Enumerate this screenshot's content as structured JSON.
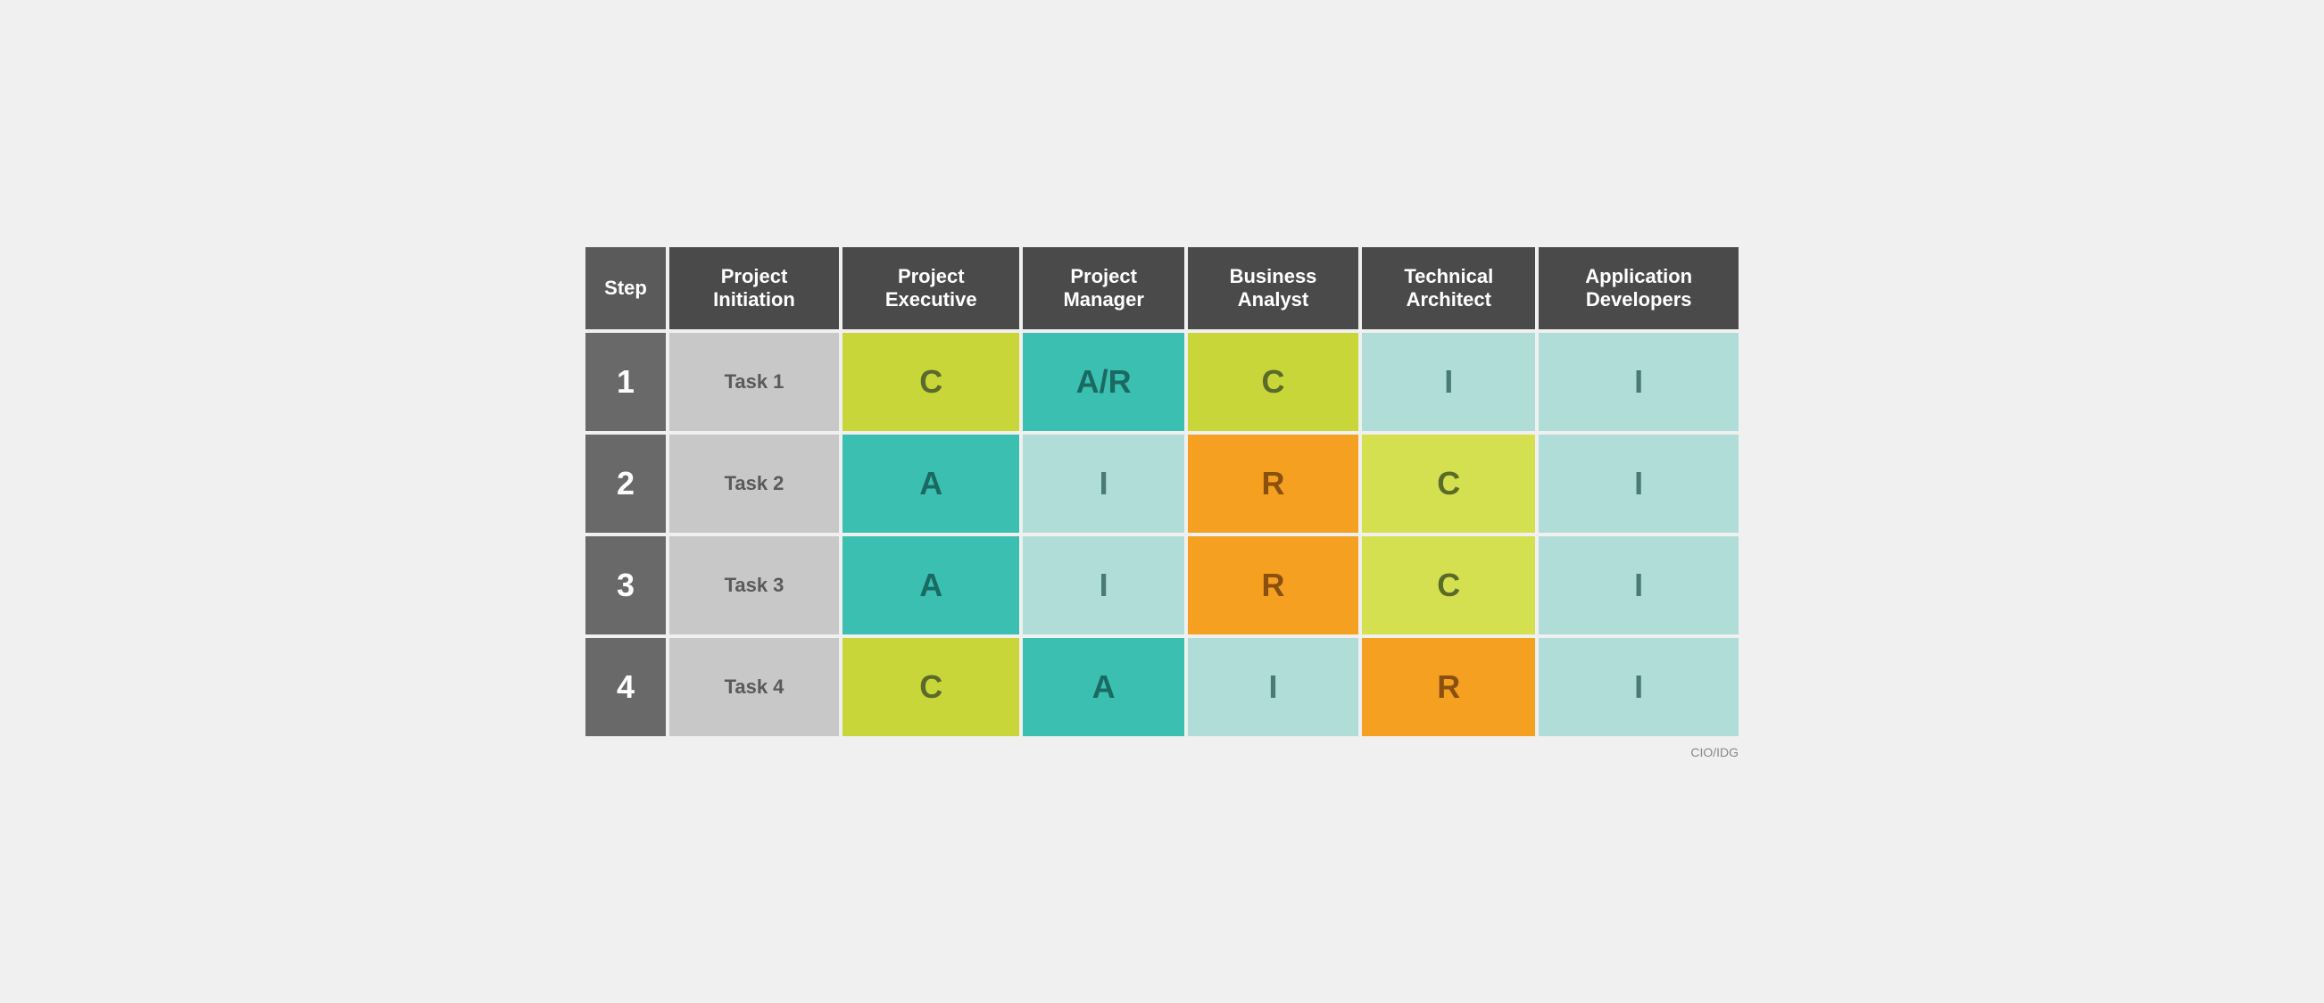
{
  "table": {
    "headers": [
      {
        "id": "step",
        "label": "Step"
      },
      {
        "id": "project-initiation",
        "label": "Project\nInitiation"
      },
      {
        "id": "project-executive",
        "label": "Project\nExecutive"
      },
      {
        "id": "project-manager",
        "label": "Project\nManager"
      },
      {
        "id": "business-analyst",
        "label": "Business\nAnalyst"
      },
      {
        "id": "technical-architect",
        "label": "Technical\nArchitect"
      },
      {
        "id": "application-developers",
        "label": "Application\nDevelopers"
      }
    ],
    "rows": [
      {
        "step": "1",
        "task": "Task 1",
        "cells": [
          {
            "value": "C",
            "color": "lime"
          },
          {
            "value": "A/R",
            "color": "teal"
          },
          {
            "value": "C",
            "color": "lime"
          },
          {
            "value": "I",
            "color": "light-teal"
          },
          {
            "value": "I",
            "color": "light-teal"
          }
        ]
      },
      {
        "step": "2",
        "task": "Task 2",
        "cells": [
          {
            "value": "A",
            "color": "teal"
          },
          {
            "value": "I",
            "color": "light-teal"
          },
          {
            "value": "R",
            "color": "orange"
          },
          {
            "value": "C",
            "color": "light-lime"
          },
          {
            "value": "I",
            "color": "light-teal"
          }
        ]
      },
      {
        "step": "3",
        "task": "Task 3",
        "cells": [
          {
            "value": "A",
            "color": "teal"
          },
          {
            "value": "I",
            "color": "light-teal"
          },
          {
            "value": "R",
            "color": "orange"
          },
          {
            "value": "C",
            "color": "light-lime"
          },
          {
            "value": "I",
            "color": "light-teal"
          }
        ]
      },
      {
        "step": "4",
        "task": "Task 4",
        "cells": [
          {
            "value": "C",
            "color": "lime"
          },
          {
            "value": "A",
            "color": "teal"
          },
          {
            "value": "I",
            "color": "light-teal"
          },
          {
            "value": "R",
            "color": "orange"
          },
          {
            "value": "I",
            "color": "light-teal"
          }
        ]
      }
    ],
    "watermark": "CIO/IDG"
  }
}
